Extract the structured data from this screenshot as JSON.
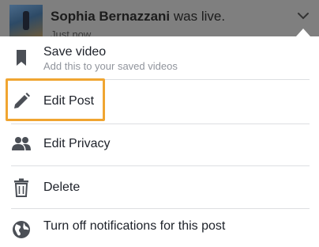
{
  "post": {
    "author": "Sophia Bernazzani",
    "action": " was live.",
    "time": "Just now"
  },
  "menu": {
    "items": [
      {
        "label": "Save video",
        "sub": "Add this to your saved videos",
        "icon": "bookmark-icon"
      },
      {
        "label": "Edit Post",
        "icon": "pencil-icon"
      },
      {
        "label": "Edit Privacy",
        "icon": "people-icon"
      },
      {
        "label": "Delete",
        "icon": "trash-icon"
      },
      {
        "label": "Turn off notifications for this post",
        "icon": "globe-icon"
      }
    ]
  },
  "colors": {
    "highlight": "#f0a531",
    "icon": "#4b4f56",
    "text": "#1d2129",
    "subtext": "#90949c"
  }
}
